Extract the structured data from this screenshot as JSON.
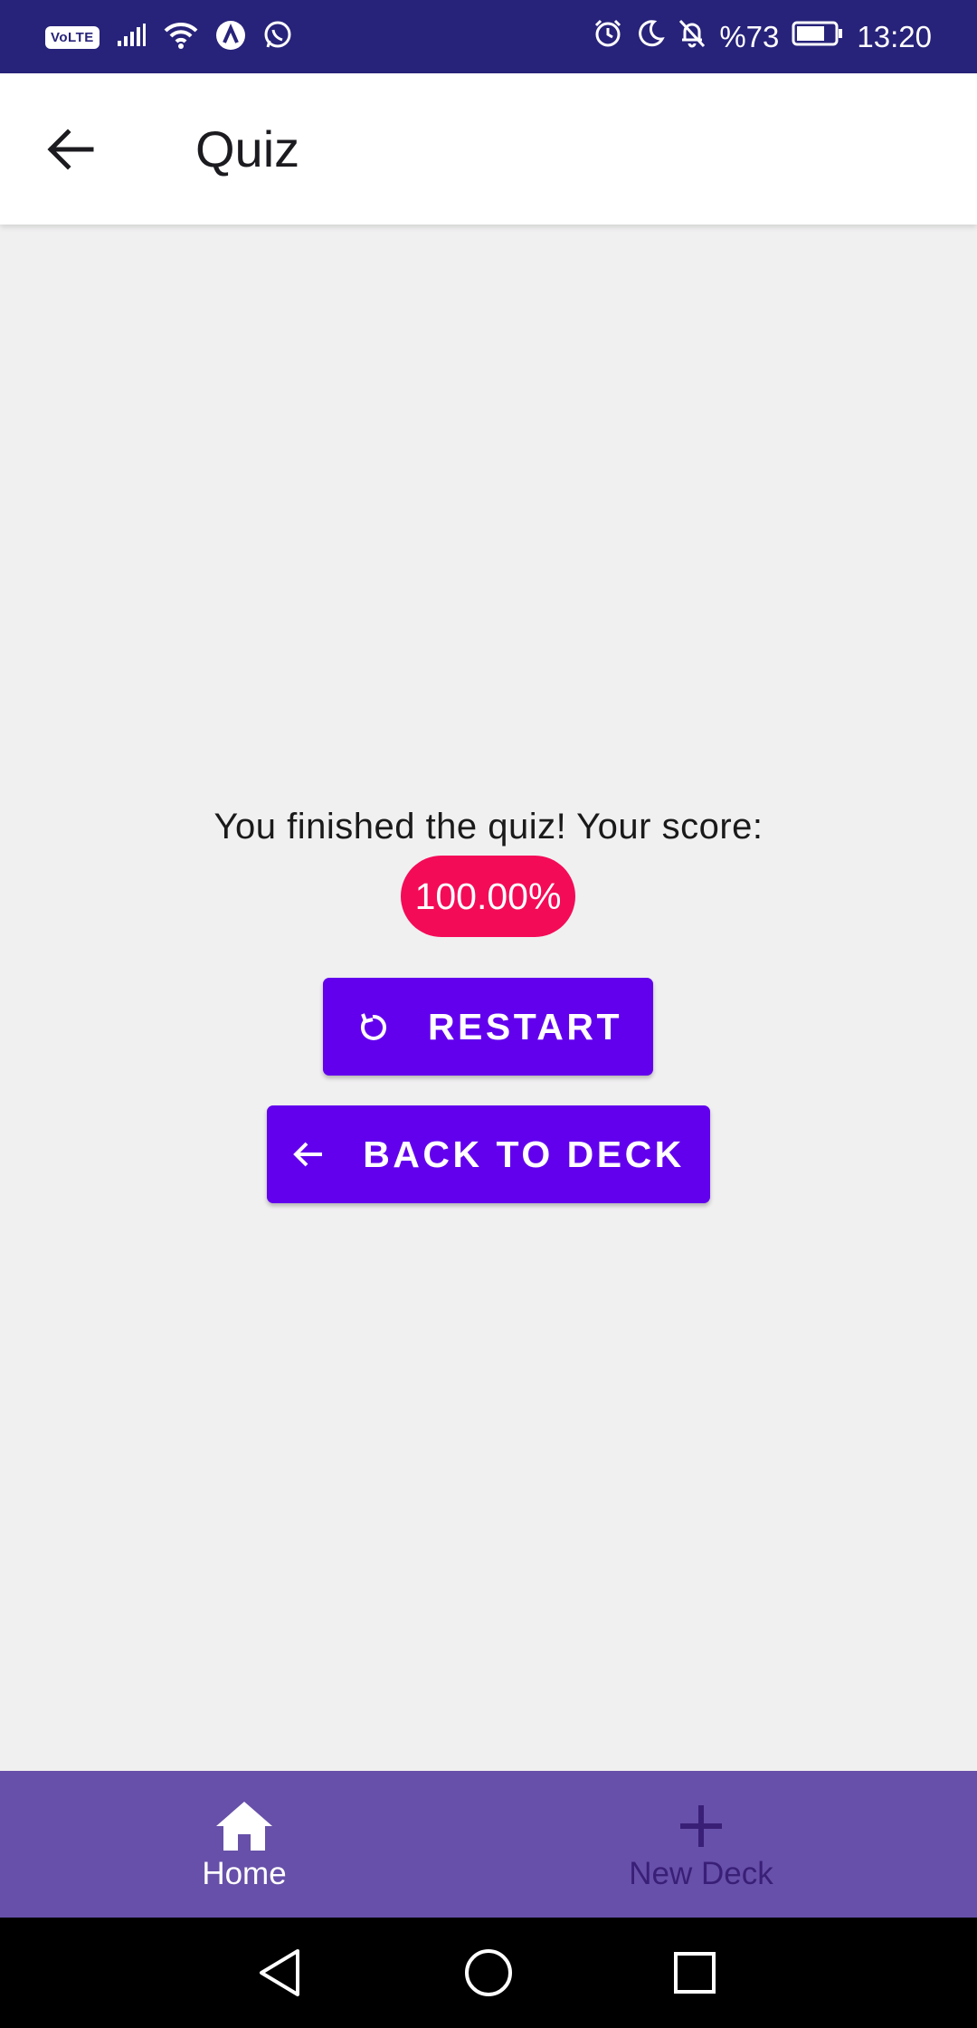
{
  "status_bar": {
    "volte": "VoLTE",
    "battery_text": "%73",
    "time": "13:20",
    "icons": [
      "signal-icon",
      "wifi-icon",
      "app-a-icon",
      "whatsapp-icon",
      "alarm-icon",
      "moon-icon",
      "bell-off-icon",
      "battery-icon"
    ]
  },
  "app_bar": {
    "title": "Quiz",
    "back_icon": "arrow-left-icon"
  },
  "result": {
    "message": "You finished the quiz! Your score:",
    "score": "100.00%",
    "score_color": "#f40b58"
  },
  "buttons": {
    "restart_label": "RESTART",
    "restart_icon": "restart-icon",
    "back_label": "BACK TO DECK",
    "back_icon": "arrow-left-icon",
    "color": "#6200ee"
  },
  "bottom_nav": {
    "items": [
      {
        "label": "Home",
        "icon": "home-icon",
        "active": true
      },
      {
        "label": "New Deck",
        "icon": "plus-icon",
        "active": false
      }
    ],
    "background": "#6750a9"
  },
  "system_nav": {
    "icons": [
      "back-triangle-icon",
      "home-circle-icon",
      "recents-square-icon"
    ]
  }
}
